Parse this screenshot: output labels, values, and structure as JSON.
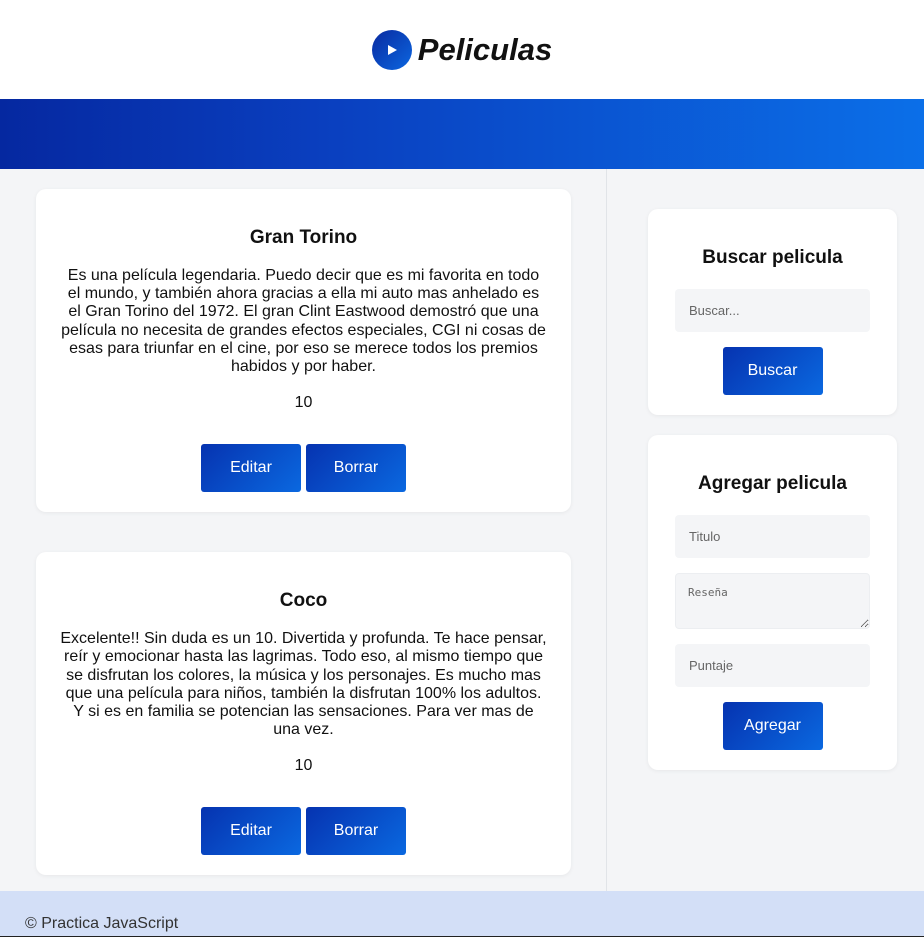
{
  "header": {
    "title": "Peliculas",
    "logo_icon": "play-icon"
  },
  "movies": [
    {
      "title": "Gran Torino",
      "review": "Es una película legendaria. Puedo decir que es mi favorita en todo el mundo, y también ahora gracias a ella mi auto mas anhelado es el Gran Torino del 1972. El gran Clint Eastwood demostró que una película no necesita de grandes efectos especiales, CGI ni cosas de esas para triunfar en el cine, por eso se merece todos los premios habidos y por haber.",
      "score": "10",
      "edit_label": "Editar",
      "delete_label": "Borrar"
    },
    {
      "title": "Coco",
      "review": "Excelente!! Sin duda es un 10. Divertida y profunda. Te hace pensar, reír y emocionar hasta las lagrimas. Todo eso, al mismo tiempo que se disfrutan los colores, la música y los personajes. Es mucho mas que una película para niños, también la disfrutan 100% los adultos. Y si es en familia se potencian las sensaciones. Para ver mas de una vez.",
      "score": "10",
      "edit_label": "Editar",
      "delete_label": "Borrar"
    }
  ],
  "search": {
    "title": "Buscar pelicula",
    "placeholder": "Buscar...",
    "button_label": "Buscar"
  },
  "add": {
    "title": "Agregar pelicula",
    "title_placeholder": "Titulo",
    "review_placeholder": "Reseña",
    "score_placeholder": "Puntaje",
    "button_label": "Agregar"
  },
  "footer": {
    "text": "© Practica JavaScript"
  },
  "colors": {
    "accent_start": "#0633b0",
    "accent_end": "#0a68e0",
    "footer_bg": "#d3dff7",
    "page_bg": "#f4f5f7"
  }
}
